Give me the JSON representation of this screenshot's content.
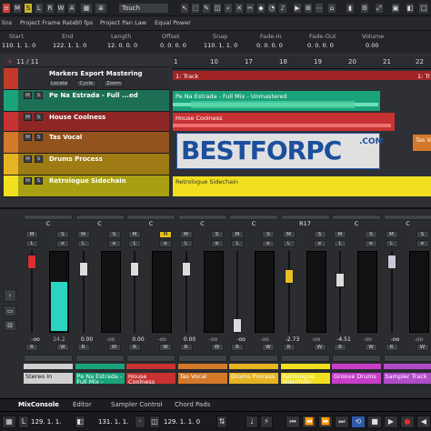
{
  "toolbar": {
    "buttons": [
      "M",
      "S",
      "L",
      "R",
      "W",
      "A"
    ],
    "automation_mode": "Touch"
  },
  "info_bar": {
    "items": [
      "lins",
      "Project Frame Rate",
      "30 fps",
      "Project Pan Law",
      "Equal Power"
    ]
  },
  "info_line": {
    "headers": [
      "Start",
      "End",
      "Length",
      "Offset",
      "Snap",
      "Fade-In",
      "Fade-Out",
      "Volume"
    ],
    "values": [
      "110. 1. 1.  0",
      "122. 1. 1.  0",
      "12. 0. 0.  0",
      "0. 0. 0.  0",
      "110. 1. 1.  0",
      "0. 0. 0.  0",
      "0. 0. 0.  0",
      "0.00"
    ]
  },
  "track_list": {
    "header": "11 / 11",
    "tracks": [
      {
        "name": "Markers Export Mastering",
        "color": "#c0392b",
        "sub": [
          "Locate",
          "Cycle",
          "Zoom"
        ]
      },
      {
        "name": "Pe Na Estrada - Full ...ed",
        "color": "#1aa37a"
      },
      {
        "name": "House Coolness",
        "color": "#c83232"
      },
      {
        "name": "Tas Vocal",
        "color": "#d4782a"
      },
      {
        "name": "Drums Process",
        "color": "#e6b422"
      },
      {
        "name": "Retrologue Sidechain",
        "color": "#f0e020"
      }
    ]
  },
  "ruler": {
    "ticks": [
      "1",
      "10",
      "17",
      "18",
      "19",
      "20",
      "21",
      "22",
      "1"
    ]
  },
  "clips": {
    "track_marker": "1: Track",
    "track_marker_right": "1: Tr",
    "pe_na": "Pe Na Estrada - Full Mix - Unmastered",
    "house": "House Coolness",
    "tas": "Tas Voc",
    "retro": "Retrologue Sidechain"
  },
  "watermark": {
    "text": "BESTFORPC",
    "suffix": ".COM"
  },
  "mixer": {
    "channels": [
      {
        "name": "Stereo In",
        "pan": "C",
        "value": "-oo",
        "peak": "24.2",
        "color": "#d0d0d0"
      },
      {
        "name": "Pe Na Estrada - Full Mix -",
        "pan": "C",
        "value": "0.00",
        "peak": "-oo",
        "color": "#1aa37a"
      },
      {
        "name": "House Coolness",
        "pan": "C",
        "value": "0.00",
        "peak": "-oo",
        "color": "#c83232"
      },
      {
        "name": "Tas Vocal",
        "pan": "C",
        "value": "0.00",
        "peak": "-oo",
        "color": "#d4782a"
      },
      {
        "name": "Drums Process",
        "pan": "C",
        "value": "-oo",
        "peak": "-oo",
        "color": "#e6b422"
      },
      {
        "name": "Retrologue Sidechain",
        "pan": "R17",
        "value": "-2.73",
        "peak": "-oo",
        "color": "#f0e020"
      },
      {
        "name": "Groove Drums",
        "pan": "C",
        "value": "-4.51",
        "peak": "-oo",
        "color": "#c83cc8"
      },
      {
        "name": "Sampler Track",
        "pan": "C",
        "value": "-oo",
        "peak": "-oo",
        "color": "#b04cc8"
      }
    ]
  },
  "bottom_tabs": [
    "MixConsole",
    "Editor",
    "Sampler Control",
    "Chord Pads"
  ],
  "transport": {
    "left_pos": "129. 1. 1.",
    "mid_pos": "131. 1. 1.",
    "right_pos": "129. 1. 1.  0"
  }
}
